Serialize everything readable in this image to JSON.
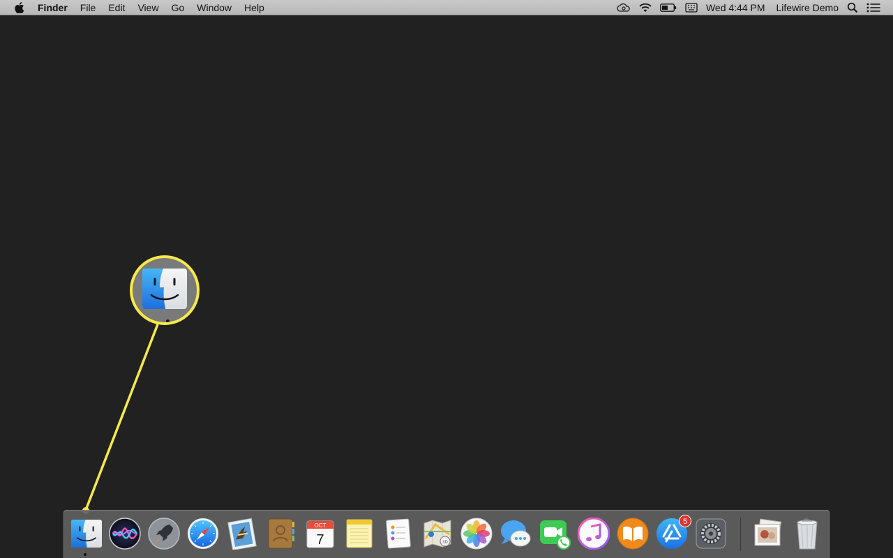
{
  "menubar": {
    "app_name": "Finder",
    "menus": [
      "File",
      "Edit",
      "View",
      "Go",
      "Window",
      "Help"
    ],
    "clock": "Wed 4:44 PM",
    "user": "Lifewire Demo"
  },
  "dock": {
    "calendar": {
      "month": "OCT",
      "day": "7"
    },
    "app_store_badge": "5",
    "apps": [
      "Finder",
      "Siri",
      "Launchpad",
      "Safari",
      "Mail",
      "Contacts",
      "Calendar",
      "Notes",
      "Reminders",
      "Maps",
      "Photos",
      "Messages",
      "FaceTime",
      "iTunes",
      "iBooks",
      "App Store",
      "System Preferences",
      "Preview",
      "Trash"
    ]
  },
  "colors": {
    "desktop": "#212121",
    "callout": "#f6e94a"
  }
}
